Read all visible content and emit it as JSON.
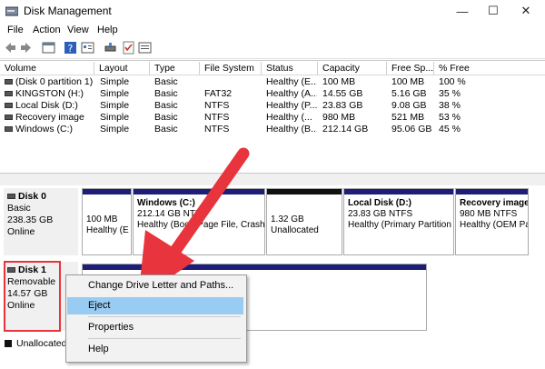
{
  "window": {
    "title": "Disk Management",
    "minimize": "—",
    "maximize": "☐",
    "close": "✕"
  },
  "menu": [
    "File",
    "Action",
    "View",
    "Help"
  ],
  "columns": [
    "Volume",
    "Layout",
    "Type",
    "File System",
    "Status",
    "Capacity",
    "Free Sp...",
    "% Free"
  ],
  "volumes": [
    {
      "name": "(Disk 0 partition 1)",
      "layout": "Simple",
      "type": "Basic",
      "fs": "",
      "status": "Healthy (E...",
      "capacity": "100 MB",
      "free": "100 MB",
      "pct": "100 %"
    },
    {
      "name": "KINGSTON (H:)",
      "layout": "Simple",
      "type": "Basic",
      "fs": "FAT32",
      "status": "Healthy (A...",
      "capacity": "14.55 GB",
      "free": "5.16 GB",
      "pct": "35 %"
    },
    {
      "name": "Local Disk (D:)",
      "layout": "Simple",
      "type": "Basic",
      "fs": "NTFS",
      "status": "Healthy (P...",
      "capacity": "23.83 GB",
      "free": "9.08 GB",
      "pct": "38 %"
    },
    {
      "name": "Recovery image",
      "layout": "Simple",
      "type": "Basic",
      "fs": "NTFS",
      "status": "Healthy (...",
      "capacity": "980 MB",
      "free": "521 MB",
      "pct": "53 %"
    },
    {
      "name": "Windows (C:)",
      "layout": "Simple",
      "type": "Basic",
      "fs": "NTFS",
      "status": "Healthy (B...",
      "capacity": "212.14 GB",
      "free": "95.06 GB",
      "pct": "45 %"
    }
  ],
  "disk0": {
    "name": "Disk 0",
    "kind": "Basic",
    "size": "238.35 GB",
    "state": "Online"
  },
  "disk0_parts": [
    {
      "title": "",
      "l1": "100 MB",
      "l2": "Healthy (E"
    },
    {
      "title": "Windows  (C:)",
      "l1": "212.14 GB NTFS",
      "l2": "Healthy (Boot, Page File, Crash D"
    },
    {
      "title": "",
      "l1": "1.32 GB",
      "l2": "Unallocated"
    },
    {
      "title": "Local Disk  (D:)",
      "l1": "23.83 GB NTFS",
      "l2": "Healthy (Primary Partition"
    },
    {
      "title": "Recovery image",
      "l1": "980 MB NTFS",
      "l2": "Healthy (OEM Pa"
    }
  ],
  "disk1": {
    "name": "Disk 1",
    "kind": "Removable",
    "size": "14.57 GB",
    "state": "Online"
  },
  "context_menu": [
    "Change Drive Letter and Paths...",
    "Eject",
    "Properties",
    "Help"
  ],
  "legend": {
    "unallocated": "Unallocated"
  },
  "colors": {
    "primary_bar": "#1e1e78",
    "unallocated_bar": "#111111",
    "highlight": "#99ccf2",
    "callout": "#e8343c"
  }
}
